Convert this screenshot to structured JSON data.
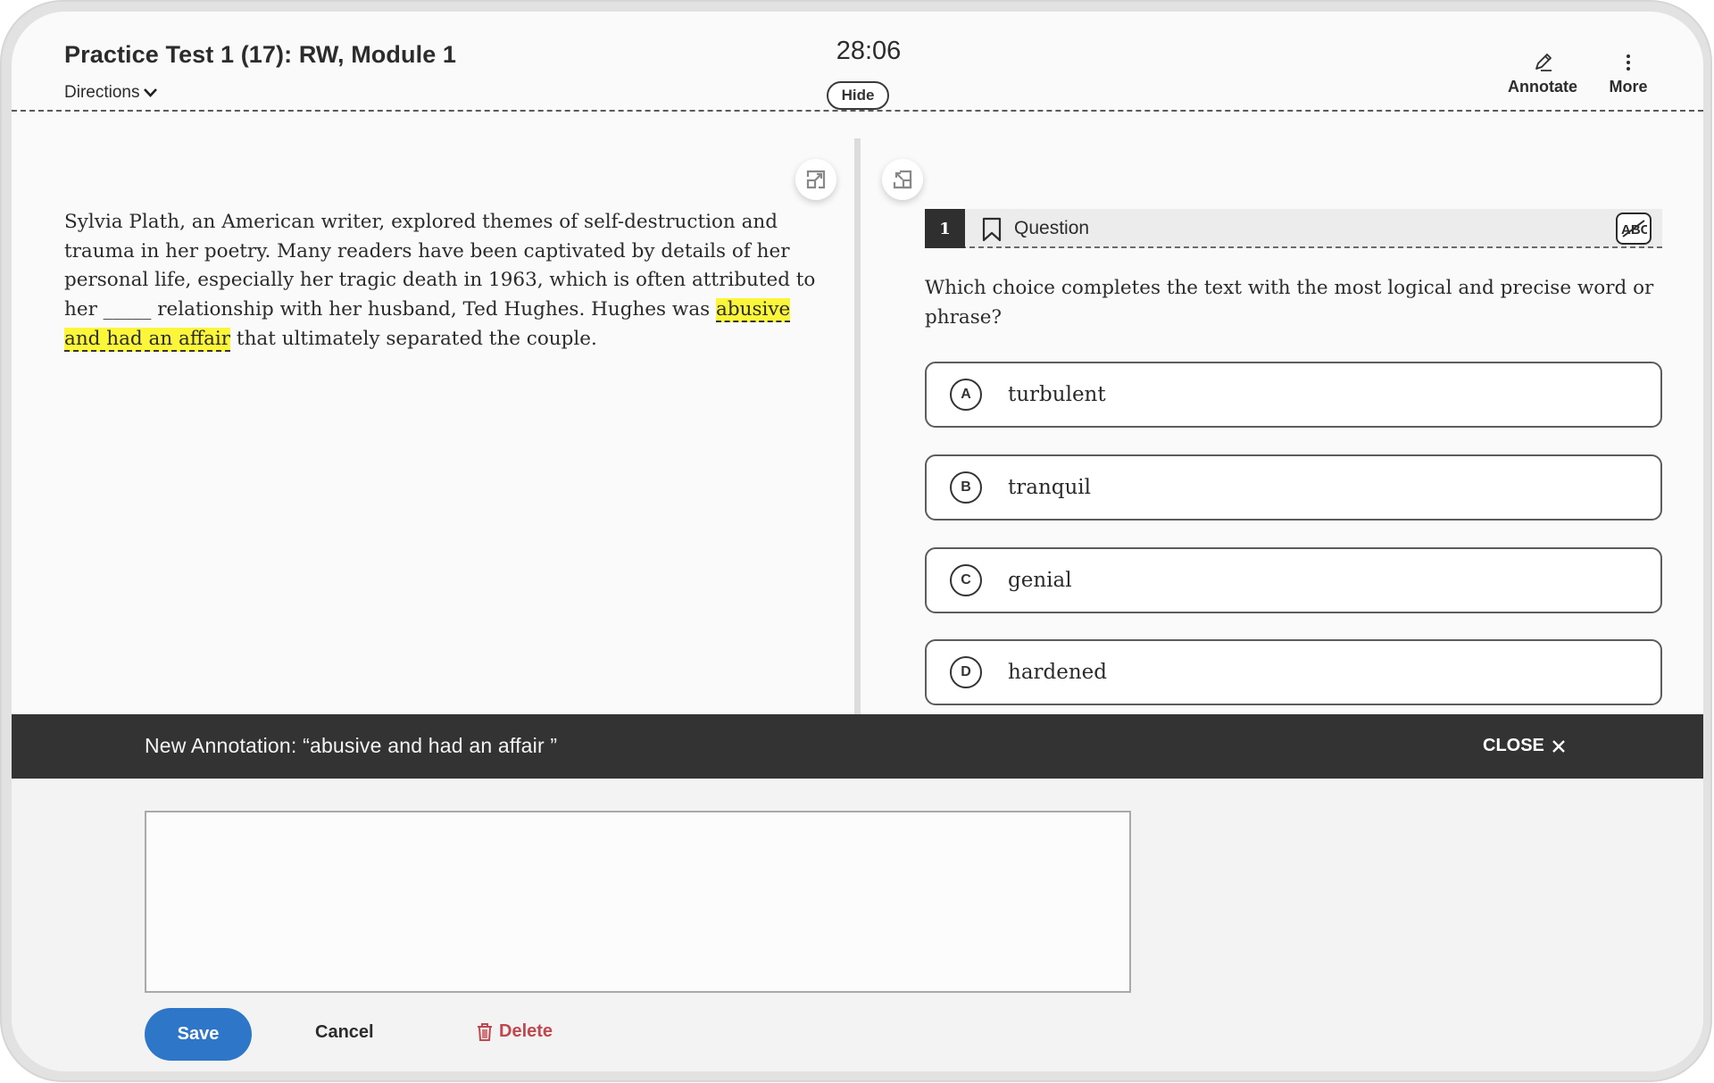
{
  "header": {
    "title": "Practice Test 1 (17): RW, Module 1",
    "directions_label": "Directions",
    "timer": "28:06",
    "hide_label": "Hide",
    "tools": [
      {
        "label": "Annotate",
        "icon": "pencil-icon"
      },
      {
        "label": "More",
        "icon": "vertical-dots-icon"
      }
    ]
  },
  "passage": {
    "before": "Sylvia Plath, an American writer, explored themes of self-destruction and trauma in her poetry. Many readers have been captivated by details of her personal life, especially her tragic death in 1963, which is often attributed to her _____ relationship with her husband, Ted Hughes. Hughes was ",
    "highlight": "abusive and had an affair",
    "after": " that ultimately separated the couple.",
    "highlight_color": "#fbf63a"
  },
  "question": {
    "number": "1",
    "label": "Question",
    "prompt": "Which choice completes the text with the most logical and precise word or phrase?",
    "options": [
      {
        "letter": "A",
        "text": "turbulent"
      },
      {
        "letter": "B",
        "text": "tranquil"
      },
      {
        "letter": "C",
        "text": "genial"
      },
      {
        "letter": "D",
        "text": "hardened"
      }
    ]
  },
  "annotation": {
    "title": "New Annotation: “abusive and had an affair ”",
    "close_label": "CLOSE",
    "input_value": "",
    "save_label": "Save",
    "cancel_label": "Cancel",
    "delete_label": "Delete"
  },
  "colors": {
    "accent": "#2e76c8",
    "danger": "#c0474d",
    "annotation_bar": "#333333"
  }
}
